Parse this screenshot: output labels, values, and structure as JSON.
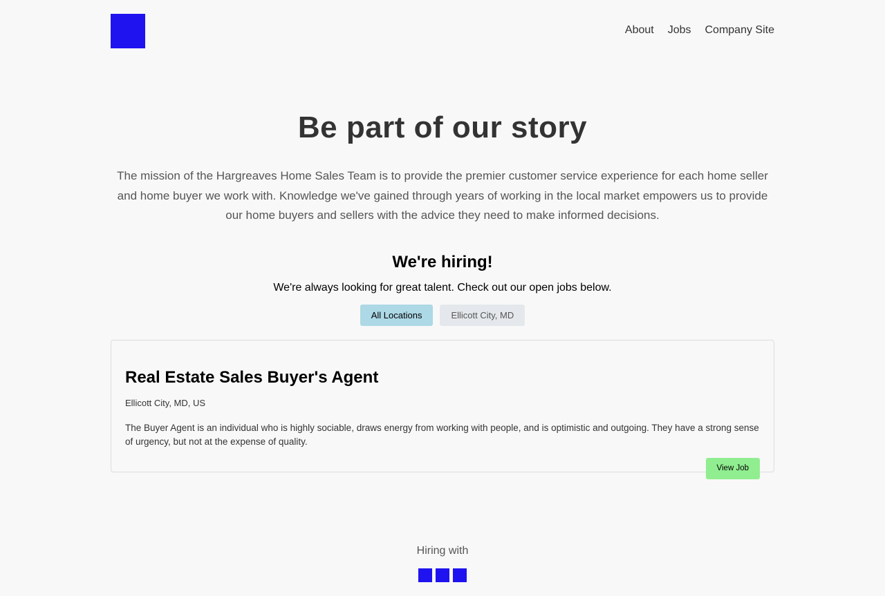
{
  "header": {
    "nav": [
      {
        "label": "About"
      },
      {
        "label": "Jobs"
      },
      {
        "label": "Company Site"
      }
    ]
  },
  "hero": {
    "title": "Be part of our story",
    "mission": "The mission of the Hargreaves Home Sales Team is to provide the premier customer service experience for each home seller and home buyer we work with. Knowledge we've gained through years of working in the local market empowers us to provide our home buyers and sellers with the advice they need to make informed decisions."
  },
  "hiring": {
    "title": "We're hiring!",
    "subtitle": "We're always looking for great talent. Check out our open jobs below.",
    "filters": [
      {
        "label": "All Locations",
        "active": true
      },
      {
        "label": "Ellicott City, MD",
        "active": false
      }
    ]
  },
  "jobs": [
    {
      "title": "Real Estate Sales Buyer's Agent",
      "location": "Ellicott City, MD, US",
      "description": "The Buyer Agent is an individual who is highly sociable, draws energy from working with people, and is optimistic and outgoing. They have a strong sense of urgency, but not at the expense of quality.",
      "button_label": "View Job"
    }
  ],
  "footer": {
    "hiring_with": "Hiring with"
  },
  "colors": {
    "brand": "#1f13f0",
    "filter_active": "#add8e6",
    "filter_inactive": "#e4e8ec",
    "view_job_button": "#90ee90",
    "background": "#f8f8f8"
  }
}
